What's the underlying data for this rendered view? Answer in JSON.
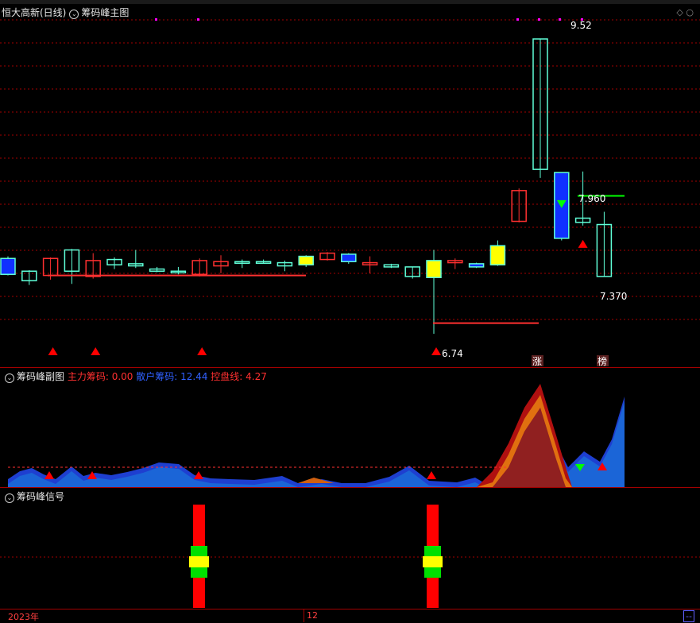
{
  "main_panel": {
    "title": "恒大高新(日线)",
    "indicator": "筹码峰主图",
    "price_labels": {
      "high": "9.52",
      "resistance": "7.960",
      "mid": "7.370",
      "low": "6.74"
    },
    "badges": [
      "涨",
      "榜"
    ]
  },
  "sub_panel": {
    "indicator": "筹码峰副图",
    "main_chip": "主力筹码: 0.00",
    "retail_chip": "散户筹码: 12.44",
    "control_line": "控盘线: 4.27"
  },
  "signal_panel": {
    "indicator": "筹码峰信号"
  },
  "time_axis": {
    "year_label": "2023年",
    "month_label": "12",
    "right_marker": "--"
  },
  "colors": {
    "up": "#ff3030",
    "down_cyan": "#5fffd8",
    "blue": "#1030ff",
    "yellow": "#ffff00",
    "grid": "#a30000"
  },
  "chart_data": {
    "type": "candlestick",
    "y_range": [
      6.5,
      9.7
    ],
    "candles": [
      {
        "o": 7.45,
        "c": 7.3,
        "h": 7.47,
        "l": 7.29,
        "col": "blue"
      },
      {
        "o": 7.33,
        "c": 7.24,
        "h": 7.34,
        "l": 7.2,
        "col": "cyan"
      },
      {
        "o": 7.29,
        "c": 7.45,
        "h": 7.46,
        "l": 7.25,
        "col": "red"
      },
      {
        "o": 7.53,
        "c": 7.33,
        "h": 7.54,
        "l": 7.21,
        "col": "cyan"
      },
      {
        "o": 7.28,
        "c": 7.43,
        "h": 7.5,
        "l": 7.26,
        "col": "red"
      },
      {
        "o": 7.44,
        "c": 7.39,
        "h": 7.46,
        "l": 7.35,
        "col": "cyan"
      },
      {
        "o": 7.4,
        "c": 7.38,
        "h": 7.53,
        "l": 7.36,
        "col": "cyan"
      },
      {
        "o": 7.35,
        "c": 7.33,
        "h": 7.37,
        "l": 7.32,
        "col": "cyan"
      },
      {
        "o": 7.33,
        "c": 7.33,
        "h": 7.37,
        "l": 7.3,
        "col": "cyan"
      },
      {
        "o": 7.3,
        "c": 7.43,
        "h": 7.45,
        "l": 7.28,
        "col": "red"
      },
      {
        "o": 7.38,
        "c": 7.42,
        "h": 7.48,
        "l": 7.31,
        "col": "red"
      },
      {
        "o": 7.42,
        "c": 7.42,
        "h": 7.44,
        "l": 7.36,
        "col": "cyan"
      },
      {
        "o": 7.42,
        "c": 7.41,
        "h": 7.44,
        "l": 7.4,
        "col": "cyan"
      },
      {
        "o": 7.41,
        "c": 7.38,
        "h": 7.43,
        "l": 7.33,
        "col": "cyan"
      },
      {
        "o": 7.47,
        "c": 7.39,
        "h": 7.48,
        "l": 7.37,
        "col": "yellow"
      },
      {
        "o": 7.44,
        "c": 7.5,
        "h": 7.51,
        "l": 7.43,
        "col": "red"
      },
      {
        "o": 7.49,
        "c": 7.42,
        "h": 7.5,
        "l": 7.4,
        "col": "blue"
      },
      {
        "o": 7.39,
        "c": 7.41,
        "h": 7.47,
        "l": 7.31,
        "col": "red"
      },
      {
        "o": 7.39,
        "c": 7.37,
        "h": 7.4,
        "l": 7.36,
        "col": "cyan"
      },
      {
        "o": 7.37,
        "c": 7.28,
        "h": 7.37,
        "l": 7.26,
        "col": "cyan"
      },
      {
        "o": 7.43,
        "c": 7.27,
        "h": 7.53,
        "l": 6.74,
        "col": "yellow"
      },
      {
        "o": 7.41,
        "c": 7.43,
        "h": 7.45,
        "l": 7.35,
        "col": "red"
      },
      {
        "o": 7.4,
        "c": 7.37,
        "h": 7.41,
        "l": 7.36,
        "col": "blue"
      },
      {
        "o": 7.57,
        "c": 7.39,
        "h": 7.62,
        "l": 7.38,
        "col": "yellow"
      },
      {
        "o": 7.8,
        "c": 8.09,
        "h": 8.11,
        "l": 7.79,
        "col": "red"
      },
      {
        "o": 9.52,
        "c": 8.29,
        "h": 9.52,
        "l": 8.21,
        "col": "cyan"
      },
      {
        "o": 8.26,
        "c": 7.64,
        "h": 8.26,
        "l": 7.62,
        "col": "blue"
      },
      {
        "o": 7.83,
        "c": 7.79,
        "h": 8.27,
        "l": 7.76,
        "col": "cyan"
      },
      {
        "o": 7.77,
        "c": 7.28,
        "h": 7.89,
        "l": 7.28,
        "col": "cyan"
      }
    ]
  }
}
